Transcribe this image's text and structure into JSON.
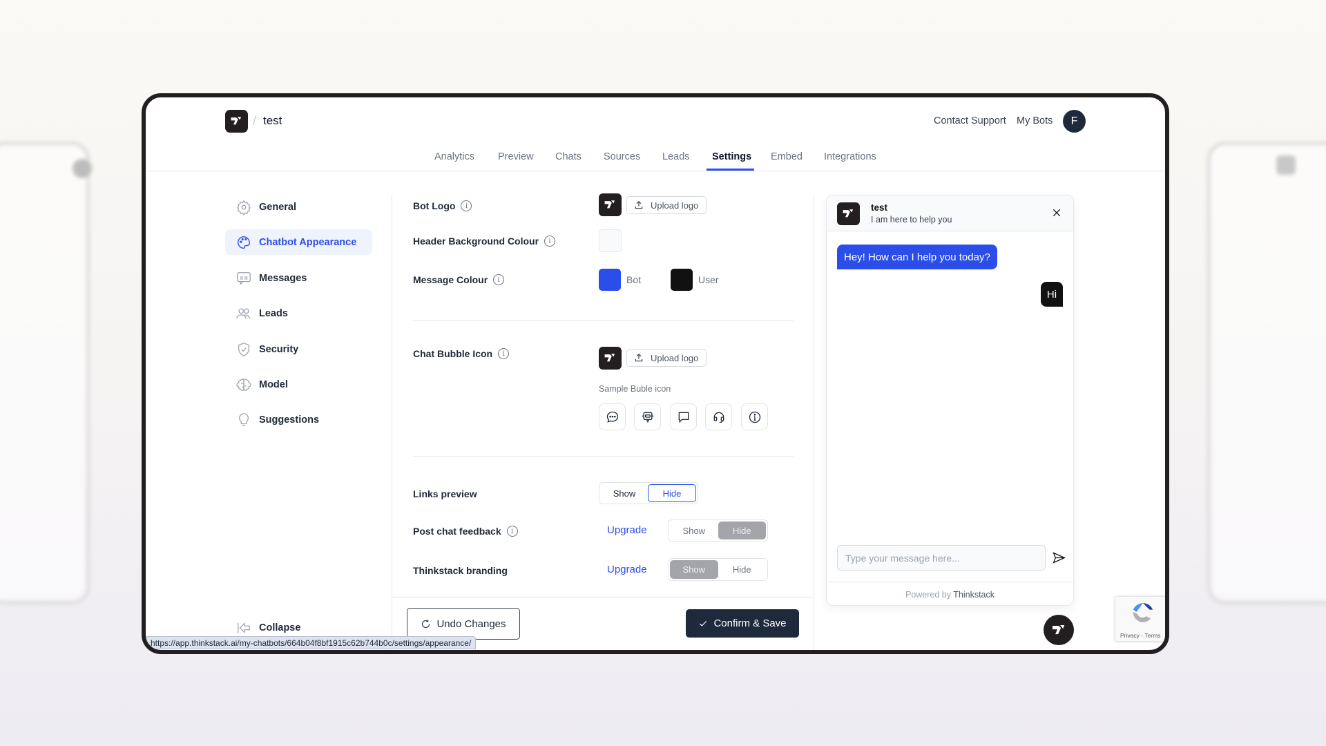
{
  "header": {
    "bot_name": "test",
    "breadcrumb_separator": "/",
    "contact_support": "Contact Support",
    "my_bots": "My Bots",
    "avatar_initial": "F"
  },
  "tabs": [
    {
      "label": "Analytics"
    },
    {
      "label": "Preview"
    },
    {
      "label": "Chats"
    },
    {
      "label": "Sources"
    },
    {
      "label": "Leads"
    },
    {
      "label": "Settings",
      "active": true
    },
    {
      "label": "Embed"
    },
    {
      "label": "Integrations"
    }
  ],
  "sidebar": {
    "items": [
      {
        "label": "General",
        "icon": "gear-icon"
      },
      {
        "label": "Chatbot Appearance",
        "icon": "palette-icon",
        "active": true
      },
      {
        "label": "Messages",
        "icon": "message-icon"
      },
      {
        "label": "Leads",
        "icon": "users-icon"
      },
      {
        "label": "Security",
        "icon": "shield-icon"
      },
      {
        "label": "Model",
        "icon": "brain-icon"
      },
      {
        "label": "Suggestions",
        "icon": "lightbulb-icon"
      }
    ],
    "collapse": "Collapse"
  },
  "settings": {
    "bot_logo": {
      "label": "Bot Logo",
      "upload": "Upload logo"
    },
    "header_bg": {
      "label": "Header Background Colour",
      "color": "#f9fafb"
    },
    "message_colour": {
      "label": "Message Colour",
      "bot_label": "Bot",
      "bot_color": "#2b4eea",
      "user_label": "User",
      "user_color": "#111111"
    },
    "chat_bubble": {
      "label": "Chat Bubble Icon",
      "upload": "Upload logo",
      "sample_label": "Sample Buble icon",
      "samples": [
        "chat-dots-icon",
        "robot-icon",
        "speech-bubble-icon",
        "headset-icon",
        "info-icon"
      ]
    },
    "links_preview": {
      "label": "Links preview",
      "options": [
        "Show",
        "Hide"
      ],
      "selected": "Hide"
    },
    "post_chat_feedback": {
      "label": "Post chat feedback",
      "upgrade": "Upgrade",
      "options": [
        "Show",
        "Hide"
      ],
      "selected": "Hide"
    },
    "branding": {
      "label": "Thinkstack branding",
      "upgrade": "Upgrade",
      "options": [
        "Show",
        "Hide"
      ],
      "selected": "Show"
    }
  },
  "actions": {
    "undo": "Undo Changes",
    "confirm": "Confirm & Save"
  },
  "preview": {
    "title": "test",
    "subtitle": "I am here to help you",
    "bot_message": "Hey! How can I help you today?",
    "user_message": "Hi",
    "input_placeholder": "Type your message here...",
    "powered_by": "Powered by",
    "powered_brand": "Thinkstack"
  },
  "recaptcha": {
    "links": "Privacy - Terms"
  },
  "status_url": "https://app.thinkstack.ai/my-chatbots/664b04f8bf1915c62b744b0c/settings/appearance/",
  "colors": {
    "accent": "#2b4eea",
    "dark": "#231f20",
    "navy": "#1e293b"
  }
}
